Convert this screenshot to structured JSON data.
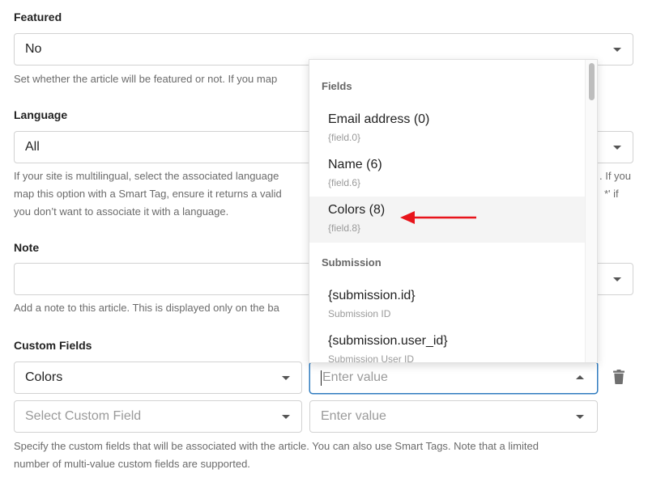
{
  "featured": {
    "label": "Featured",
    "value": "No",
    "help": "Set whether the article will be featured or not. If you map"
  },
  "language": {
    "label": "Language",
    "value": "All",
    "help_line1": "If your site is multilingual, select the associated language",
    "help_line1_end": ". If you",
    "help_line2": "map this option with a Smart Tag, ensure it returns a valid",
    "help_line2_end": "*' if",
    "help_line3": "you don’t want to associate it with a language."
  },
  "note": {
    "label": "Note",
    "value": "",
    "help": "Add a note to this article. This is displayed only on the ba"
  },
  "custom_fields": {
    "label": "Custom Fields",
    "rows": [
      {
        "field": "Colors",
        "value_placeholder": "Enter value"
      },
      {
        "field_placeholder": "Select Custom Field",
        "value_placeholder": "Enter value"
      }
    ],
    "help_line1": "Specify the custom fields that will be associated with the article. You can also use Smart Tags. Note that a limited",
    "help_line2": "number of multi-value custom fields are supported."
  },
  "dropdown": {
    "groups": [
      {
        "label": "Fields",
        "options": [
          {
            "title": "Email address (0)",
            "tag": "{field.0}"
          },
          {
            "title": "Name (6)",
            "tag": "{field.6}"
          },
          {
            "title": "Colors (8)",
            "tag": "{field.8}"
          }
        ]
      },
      {
        "label": "Submission",
        "options": [
          {
            "title": "{submission.id}",
            "tag": "Submission ID"
          },
          {
            "title": "{submission.user_id}",
            "tag": "Submission User ID"
          }
        ]
      }
    ]
  },
  "colors": {
    "accent": "#2f7bbf",
    "annotation_arrow": "#e8141b",
    "hover_bg": "#f4f4f4"
  }
}
